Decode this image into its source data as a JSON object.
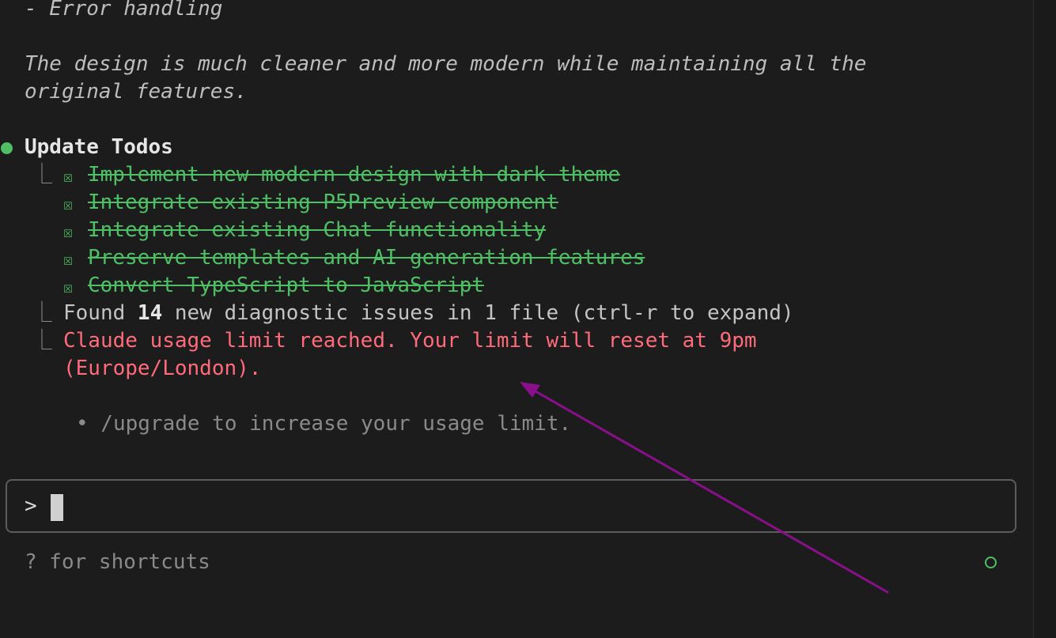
{
  "conversation": {
    "prev_line": "- Error handling",
    "summary_line1": "The design is much cleaner and more modern while maintaining all the",
    "summary_line2": "original features.",
    "todos_title": "Update Todos",
    "todo_checkbox_glyph": "☒",
    "todos": [
      "Implement new modern design with dark theme",
      "Integrate existing P5Preview component",
      "Integrate existing Chat functionality",
      "Preserve templates and AI generation features",
      "Convert TypeScript to JavaScript"
    ],
    "branch_glyph": "⎿",
    "diagnostic": {
      "prefix": "Found ",
      "count": "14",
      "suffix": " new diagnostic issues in 1 file (ctrl-r to expand)"
    },
    "error_line1": "Claude usage limit reached. Your limit will reset at 9pm",
    "error_line2": "(Europe/London).",
    "tip": "• /upgrade to increase your usage limit."
  },
  "input": {
    "prompt_symbol": ">",
    "value": ""
  },
  "footer": {
    "shortcuts_hint": "? for shortcuts"
  },
  "colors": {
    "background": "#1c1c1c",
    "done_green": "#4fbf65",
    "error_red": "#ff6b7a",
    "annotation_arrow": "#8a0f8a"
  },
  "icons": {
    "status_bullet": "green-dot-icon",
    "status_indicator": "green-ring-icon",
    "annotation": "purple-arrow-icon"
  }
}
